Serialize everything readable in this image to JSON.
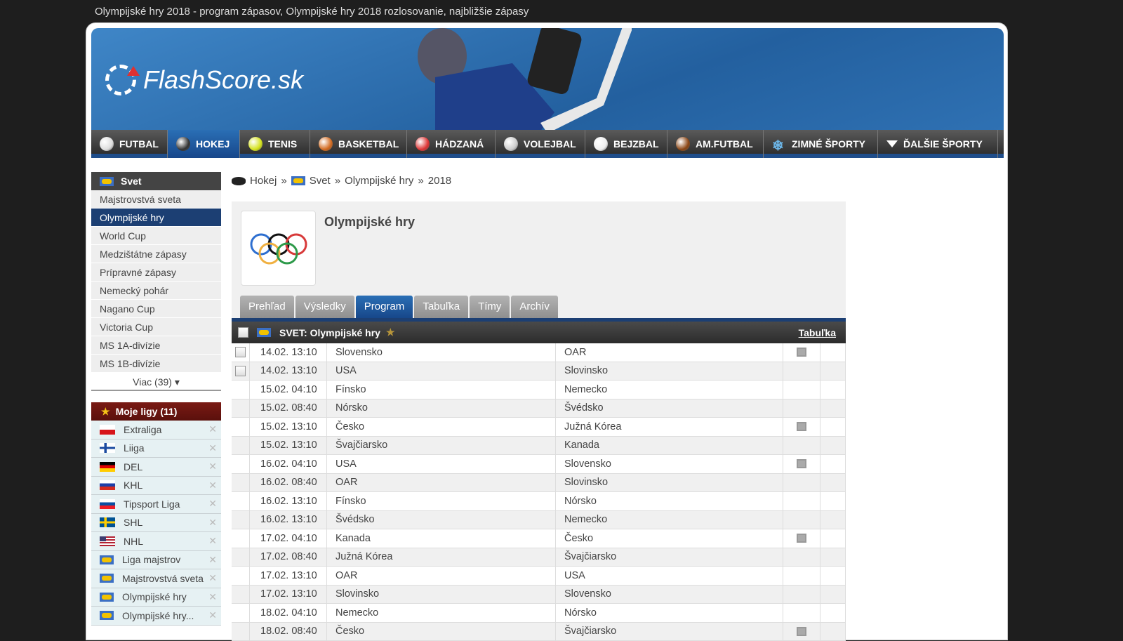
{
  "window_title": "Olympijské hry 2018 - program zápasov, Olympijské hry 2018 rozlosovanie, najbližšie zápasy",
  "logo": "FlashScore.sk",
  "nav": [
    {
      "label": "FUTBAL",
      "icon": "soccer-ball-icon",
      "color": "#ddd"
    },
    {
      "label": "HOKEJ",
      "icon": "puck-icon",
      "color": "#333",
      "active": true
    },
    {
      "label": "TENIS",
      "icon": "tennis-ball-icon",
      "color": "#d4e21a"
    },
    {
      "label": "BASKETBAL",
      "icon": "basketball-icon",
      "color": "#d2691e"
    },
    {
      "label": "HÁDZANÁ",
      "icon": "handball-icon",
      "color": "#d33"
    },
    {
      "label": "VOLEJBAL",
      "icon": "volleyball-icon",
      "color": "#ccc"
    },
    {
      "label": "BEJZBAL",
      "icon": "baseball-icon",
      "color": "#eee"
    },
    {
      "label": "AM.FUTBAL",
      "icon": "football-icon",
      "color": "#8b4513"
    },
    {
      "label": "ZIMNÉ ŠPORTY",
      "icon": "snowflake-icon",
      "color": "#6cb6e8"
    },
    {
      "label": "ĎALŠIE ŠPORTY",
      "icon": "triangle-down-icon",
      "color": "#fff"
    }
  ],
  "sidebar": {
    "header": "Svet",
    "items": [
      "Majstrovstvá sveta",
      "Olympijské hry",
      "World Cup",
      "Medzištátne zápasy",
      "Prípravné zápasy",
      "Nemecký pohár",
      "Nagano Cup",
      "Victoria Cup",
      "MS 1A-divízie",
      "MS 1B-divízie"
    ],
    "active": "Olympijské hry",
    "more": "Viac (39) ▾"
  },
  "my_leagues": {
    "header": "Moje ligy (11)",
    "items": [
      {
        "label": "Extraliga",
        "flag": "cz"
      },
      {
        "label": "Liiga",
        "flag": "fi"
      },
      {
        "label": "DEL",
        "flag": "de"
      },
      {
        "label": "KHL",
        "flag": "ru"
      },
      {
        "label": "Tipsport Liga",
        "flag": "sk"
      },
      {
        "label": "SHL",
        "flag": "se"
      },
      {
        "label": "NHL",
        "flag": "us"
      },
      {
        "label": "Liga majstrov",
        "flag": "world"
      },
      {
        "label": "Majstrovstvá sveta",
        "flag": "world"
      },
      {
        "label": "Olympijské hry",
        "flag": "world"
      },
      {
        "label": "Olympijské hry...",
        "flag": "world"
      }
    ]
  },
  "breadcrumb": {
    "sport": "Hokej",
    "sep": "»",
    "country": "Svet",
    "competition": "Olympijské hry",
    "season": "2018"
  },
  "competition_title": "Olympijské hry",
  "tabs": [
    "Prehľad",
    "Výsledky",
    "Program",
    "Tabuľka",
    "Tímy",
    "Archív"
  ],
  "active_tab": "Program",
  "table": {
    "header": "SVET: Olympijské hry",
    "link": "Tabuľka",
    "rows": [
      {
        "time": "14.02. 13:10",
        "home": "Slovensko",
        "away": "OAR",
        "tv": true,
        "checkbox": true
      },
      {
        "time": "14.02. 13:10",
        "home": "USA",
        "away": "Slovinsko",
        "tv": false,
        "checkbox": true
      },
      {
        "time": "15.02. 04:10",
        "home": "Fínsko",
        "away": "Nemecko",
        "tv": false
      },
      {
        "time": "15.02. 08:40",
        "home": "Nórsko",
        "away": "Švédsko",
        "tv": false
      },
      {
        "time": "15.02. 13:10",
        "home": "Česko",
        "away": "Južná Kórea",
        "tv": true
      },
      {
        "time": "15.02. 13:10",
        "home": "Švajčiarsko",
        "away": "Kanada",
        "tv": false
      },
      {
        "time": "16.02. 04:10",
        "home": "USA",
        "away": "Slovensko",
        "tv": true
      },
      {
        "time": "16.02. 08:40",
        "home": "OAR",
        "away": "Slovinsko",
        "tv": false
      },
      {
        "time": "16.02. 13:10",
        "home": "Fínsko",
        "away": "Nórsko",
        "tv": false
      },
      {
        "time": "16.02. 13:10",
        "home": "Švédsko",
        "away": "Nemecko",
        "tv": false
      },
      {
        "time": "17.02. 04:10",
        "home": "Kanada",
        "away": "Česko",
        "tv": true
      },
      {
        "time": "17.02. 08:40",
        "home": "Južná Kórea",
        "away": "Švajčiarsko",
        "tv": false
      },
      {
        "time": "17.02. 13:10",
        "home": "OAR",
        "away": "USA",
        "tv": false
      },
      {
        "time": "17.02. 13:10",
        "home": "Slovinsko",
        "away": "Slovensko",
        "tv": false
      },
      {
        "time": "18.02. 04:10",
        "home": "Nemecko",
        "away": "Nórsko",
        "tv": false
      },
      {
        "time": "18.02. 08:40",
        "home": "Česko",
        "away": "Švajčiarsko",
        "tv": true
      }
    ]
  }
}
